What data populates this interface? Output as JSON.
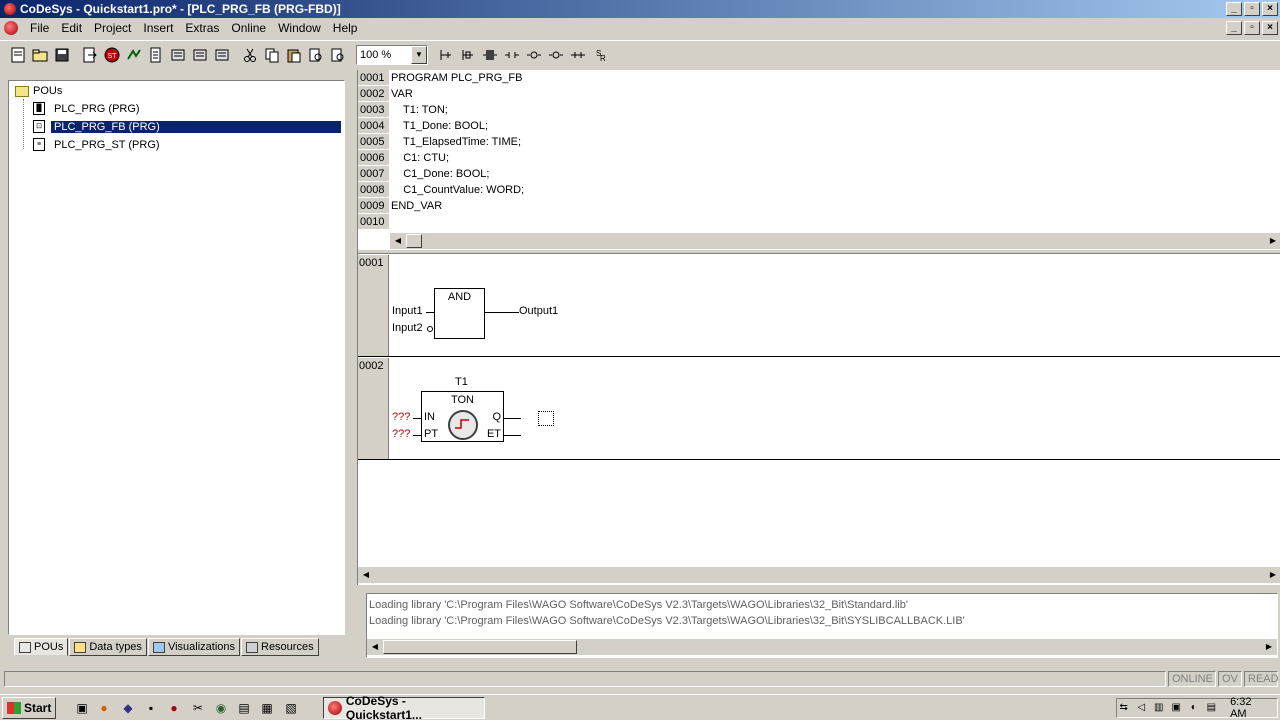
{
  "window": {
    "title": "CoDeSys - Quickstart1.pro* - [PLC_PRG_FB (PRG-FBD)]",
    "btn_min": "_",
    "btn_max": "▫",
    "btn_close": "×"
  },
  "menu": {
    "items": [
      "File",
      "Edit",
      "Project",
      "Insert",
      "Extras",
      "Online",
      "Window",
      "Help"
    ]
  },
  "toolbar": {
    "zoom": "100 %"
  },
  "pou_tree": {
    "root": "POUs",
    "items": [
      {
        "label": "PLC_PRG (PRG)"
      },
      {
        "label": "PLC_PRG_FB (PRG)"
      },
      {
        "label": "PLC_PRG_ST (PRG)"
      }
    ]
  },
  "left_tabs": [
    "POUs",
    "Data types",
    "Visualizations",
    "Resources"
  ],
  "declaration": {
    "lines": [
      {
        "num": "0001",
        "text": "PROGRAM PLC_PRG_FB"
      },
      {
        "num": "0002",
        "text": "VAR"
      },
      {
        "num": "0003",
        "text": "    T1: TON;"
      },
      {
        "num": "0004",
        "text": "    T1_Done: BOOL;"
      },
      {
        "num": "0005",
        "text": "    T1_ElapsedTime: TIME;"
      },
      {
        "num": "0006",
        "text": "    C1: CTU;"
      },
      {
        "num": "0007",
        "text": "    C1_Done: BOOL;"
      },
      {
        "num": "0008",
        "text": "    C1_CountValue: WORD;"
      },
      {
        "num": "0009",
        "text": "END_VAR"
      },
      {
        "num": "0010",
        "text": ""
      }
    ]
  },
  "networks": [
    {
      "num": "0001",
      "block": "AND",
      "inputs": [
        "Input1",
        "Input2"
      ],
      "output": "Output1"
    },
    {
      "num": "0002",
      "instance": "T1",
      "block": "TON",
      "in_labels": [
        "IN",
        "PT"
      ],
      "out_labels": [
        "Q",
        "ET"
      ],
      "unknown": "???"
    }
  ],
  "messages": [
    "Loading library 'C:\\Program Files\\WAGO Software\\CoDeSys V2.3\\Targets\\WAGO\\Libraries\\32_Bit\\Standard.lib'",
    "Loading library 'C:\\Program Files\\WAGO Software\\CoDeSys V2.3\\Targets\\WAGO\\Libraries\\32_Bit\\SYSLIBCALLBACK.LIB'"
  ],
  "status": {
    "online": "ONLINE",
    "ov": "OV",
    "read": "READ"
  },
  "taskbar": {
    "start": "Start",
    "task": "CoDeSys - Quickstart1...",
    "clock": "6:32 AM"
  }
}
